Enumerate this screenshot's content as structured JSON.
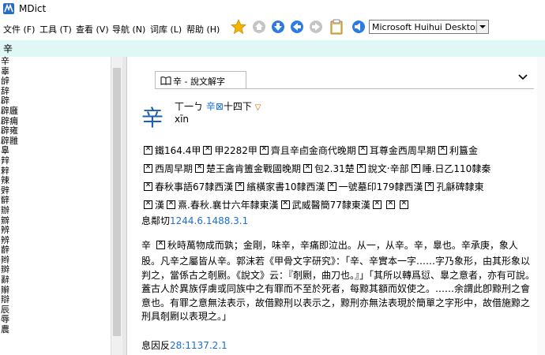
{
  "window": {
    "title": "MDict"
  },
  "menu": [
    "文件 (F)",
    "工具 (T)",
    "查看 (V)",
    "导航 (N)",
    "词库 (L)",
    "帮助 (H)"
  ],
  "toolbar": {
    "icons": [
      "star-icon",
      "home-icon",
      "down-arrow-icon",
      "back-arrow-icon",
      "forward-arrow-icon",
      "clipboard-icon",
      "speaker-icon"
    ],
    "dictionary_selected": "Microsoft Huihui Desktop - C"
  },
  "search": {
    "value": "辛"
  },
  "wordlist": [
    "辛",
    "辜",
    "辝",
    "辞",
    "辟",
    "辟廱",
    "辟痈",
    "辟雍",
    "辟雝",
    "辠",
    "辡",
    "辢",
    "辣",
    "辤",
    "辥",
    "辦",
    "辧",
    "辨",
    "辨",
    "辪",
    "辫",
    "辬",
    "辭",
    "辮",
    "辯",
    "辰",
    "辱",
    "農"
  ],
  "entry": {
    "tab_label": "辛 - 說文解字",
    "headword": "辛",
    "radical_prefix": "丅一ㄅ",
    "radical_link": "辛⊠",
    "radical_suffix": "十四下",
    "pinyin": "xīn",
    "variants": [
      [
        "鐵164.4甲",
        "甲2282甲",
        "齊且辛卣金商代晚期",
        "耳尊金西周早期",
        "利簋金"
      ],
      [
        "西周早期",
        "楚王酓肯簠金戰國晚期",
        "包2.31楚",
        "說文‧辛部",
        "睡.日乙110隸秦"
      ],
      [
        "春秋事語67隸西漢",
        "繽橫家書10隸西漢",
        "一號墓印179隸西漢",
        "孔龢碑隸東"
      ],
      [
        "漢",
        "熹.春秋.襄廿六年隸東漢",
        "武威醫簡77隸東漢"
      ]
    ],
    "ref_label": "息鄰切",
    "ref_num": "1244.6.1488.3.1",
    "paragraph": "秋時萬物成而孰；金剛，味辛，辛痛即泣出。从一，从辛。辛，辠也。辛承庚，象人股。凡辛之屬皆从辛。郭沫若《甲骨文字研究》：「辛、辛實本一字……字乃象形，由其形象以判之，當係古之剞劂。《說文》云：『剞劂，曲刀也。』」「其所以轉爲愆、辠之意者，亦有可說。蓋古人於異族俘虜或同族中之有罪而不至於死者，每黥其額而奴使之。……余謂此卽黥刑之會意也。有罪之意無法表示，故借黥刑以表示之，黥刑亦無法表現於簡單之字形中，故借施黥之刑具剞劂以表現之。」",
    "fanqie_label": "息因反",
    "fanqie_num": "28:1137.2.1"
  },
  "colors": {
    "accent": "#1c6fd0",
    "search_bg": "#e1f7f5"
  }
}
